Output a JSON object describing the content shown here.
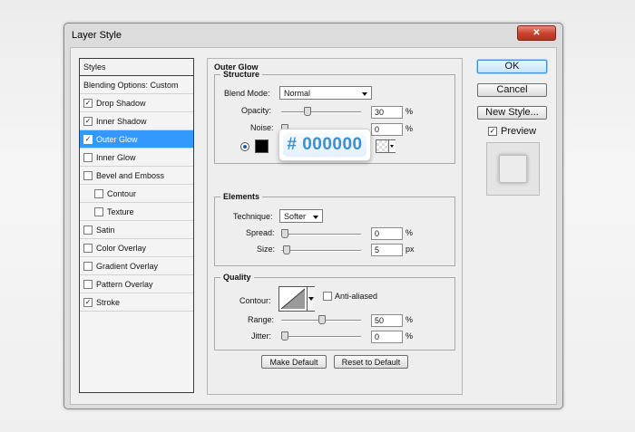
{
  "window": {
    "title": "Layer Style"
  },
  "styles_panel": {
    "header": "Styles",
    "items": [
      {
        "label": "Blending Options: Custom",
        "has_checkbox": false,
        "checked": false,
        "selected": false,
        "indent": false
      },
      {
        "label": "Drop Shadow",
        "has_checkbox": true,
        "checked": true,
        "selected": false,
        "indent": false
      },
      {
        "label": "Inner Shadow",
        "has_checkbox": true,
        "checked": true,
        "selected": false,
        "indent": false
      },
      {
        "label": "Outer Glow",
        "has_checkbox": true,
        "checked": true,
        "selected": true,
        "indent": false
      },
      {
        "label": "Inner Glow",
        "has_checkbox": true,
        "checked": false,
        "selected": false,
        "indent": false
      },
      {
        "label": "Bevel and Emboss",
        "has_checkbox": true,
        "checked": false,
        "selected": false,
        "indent": false
      },
      {
        "label": "Contour",
        "has_checkbox": true,
        "checked": false,
        "selected": false,
        "indent": true
      },
      {
        "label": "Texture",
        "has_checkbox": true,
        "checked": false,
        "selected": false,
        "indent": true
      },
      {
        "label": "Satin",
        "has_checkbox": true,
        "checked": false,
        "selected": false,
        "indent": false
      },
      {
        "label": "Color Overlay",
        "has_checkbox": true,
        "checked": false,
        "selected": false,
        "indent": false
      },
      {
        "label": "Gradient Overlay",
        "has_checkbox": true,
        "checked": false,
        "selected": false,
        "indent": false
      },
      {
        "label": "Pattern Overlay",
        "has_checkbox": true,
        "checked": false,
        "selected": false,
        "indent": false
      },
      {
        "label": "Stroke",
        "has_checkbox": true,
        "checked": true,
        "selected": false,
        "indent": false
      }
    ]
  },
  "outer_glow": {
    "title": "Outer Glow",
    "structure": {
      "title": "Structure",
      "blend_mode_label": "Blend Mode:",
      "blend_mode_value": "Normal",
      "opacity_label": "Opacity:",
      "opacity_value": "30",
      "opacity_unit": "%",
      "opacity_level": 0.3,
      "noise_label": "Noise:",
      "noise_value": "0",
      "noise_unit": "%",
      "noise_level": 0.0,
      "color_hex_callout": "# 000000",
      "color": "#000000"
    },
    "elements": {
      "title": "Elements",
      "technique_label": "Technique:",
      "technique_value": "Softer",
      "spread_label": "Spread:",
      "spread_value": "0",
      "spread_unit": "%",
      "spread_level": 0.0,
      "size_label": "Size:",
      "size_value": "5",
      "size_unit": "px",
      "size_level": 0.02
    },
    "quality": {
      "title": "Quality",
      "contour_label": "Contour:",
      "anti_aliased_label": "Anti-aliased",
      "range_label": "Range:",
      "range_value": "50",
      "range_unit": "%",
      "range_level": 0.5,
      "jitter_label": "Jitter:",
      "jitter_value": "0",
      "jitter_unit": "%",
      "jitter_level": 0.0
    },
    "make_default_label": "Make Default",
    "reset_default_label": "Reset to Default"
  },
  "actions": {
    "ok_label": "OK",
    "cancel_label": "Cancel",
    "new_style_label": "New Style...",
    "preview_label": "Preview",
    "preview_checked": true
  },
  "colors": {
    "selection": "#3399ff",
    "callout_text": "#3d8fd0",
    "close_button": "#c8402b"
  }
}
